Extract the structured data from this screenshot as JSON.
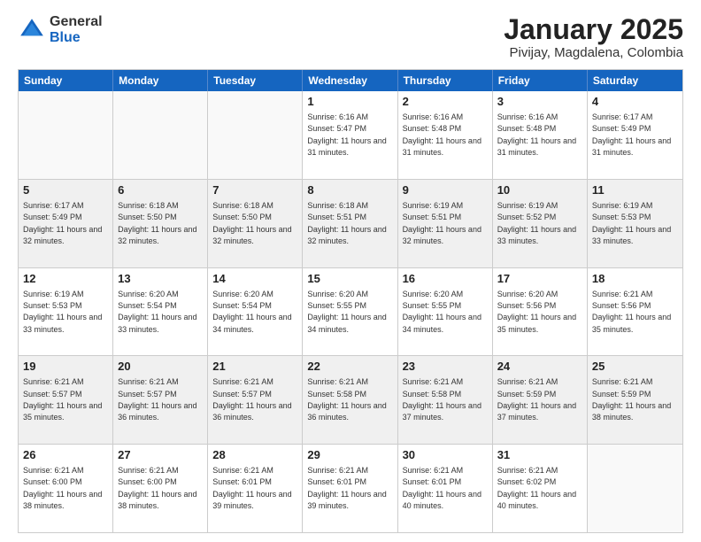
{
  "header": {
    "logo_general": "General",
    "logo_blue": "Blue",
    "title": "January 2025",
    "subtitle": "Pivijay, Magdalena, Colombia"
  },
  "calendar": {
    "days": [
      "Sunday",
      "Monday",
      "Tuesday",
      "Wednesday",
      "Thursday",
      "Friday",
      "Saturday"
    ],
    "weeks": [
      [
        {
          "day": "",
          "empty": true
        },
        {
          "day": "",
          "empty": true
        },
        {
          "day": "",
          "empty": true
        },
        {
          "day": "1",
          "sunrise": "6:16 AM",
          "sunset": "5:47 PM",
          "daylight": "11 hours and 31 minutes."
        },
        {
          "day": "2",
          "sunrise": "6:16 AM",
          "sunset": "5:48 PM",
          "daylight": "11 hours and 31 minutes."
        },
        {
          "day": "3",
          "sunrise": "6:16 AM",
          "sunset": "5:48 PM",
          "daylight": "11 hours and 31 minutes."
        },
        {
          "day": "4",
          "sunrise": "6:17 AM",
          "sunset": "5:49 PM",
          "daylight": "11 hours and 31 minutes."
        }
      ],
      [
        {
          "day": "5",
          "sunrise": "6:17 AM",
          "sunset": "5:49 PM",
          "daylight": "11 hours and 32 minutes."
        },
        {
          "day": "6",
          "sunrise": "6:18 AM",
          "sunset": "5:50 PM",
          "daylight": "11 hours and 32 minutes."
        },
        {
          "day": "7",
          "sunrise": "6:18 AM",
          "sunset": "5:50 PM",
          "daylight": "11 hours and 32 minutes."
        },
        {
          "day": "8",
          "sunrise": "6:18 AM",
          "sunset": "5:51 PM",
          "daylight": "11 hours and 32 minutes."
        },
        {
          "day": "9",
          "sunrise": "6:19 AM",
          "sunset": "5:51 PM",
          "daylight": "11 hours and 32 minutes."
        },
        {
          "day": "10",
          "sunrise": "6:19 AM",
          "sunset": "5:52 PM",
          "daylight": "11 hours and 33 minutes."
        },
        {
          "day": "11",
          "sunrise": "6:19 AM",
          "sunset": "5:53 PM",
          "daylight": "11 hours and 33 minutes."
        }
      ],
      [
        {
          "day": "12",
          "sunrise": "6:19 AM",
          "sunset": "5:53 PM",
          "daylight": "11 hours and 33 minutes."
        },
        {
          "day": "13",
          "sunrise": "6:20 AM",
          "sunset": "5:54 PM",
          "daylight": "11 hours and 33 minutes."
        },
        {
          "day": "14",
          "sunrise": "6:20 AM",
          "sunset": "5:54 PM",
          "daylight": "11 hours and 34 minutes."
        },
        {
          "day": "15",
          "sunrise": "6:20 AM",
          "sunset": "5:55 PM",
          "daylight": "11 hours and 34 minutes."
        },
        {
          "day": "16",
          "sunrise": "6:20 AM",
          "sunset": "5:55 PM",
          "daylight": "11 hours and 34 minutes."
        },
        {
          "day": "17",
          "sunrise": "6:20 AM",
          "sunset": "5:56 PM",
          "daylight": "11 hours and 35 minutes."
        },
        {
          "day": "18",
          "sunrise": "6:21 AM",
          "sunset": "5:56 PM",
          "daylight": "11 hours and 35 minutes."
        }
      ],
      [
        {
          "day": "19",
          "sunrise": "6:21 AM",
          "sunset": "5:57 PM",
          "daylight": "11 hours and 35 minutes."
        },
        {
          "day": "20",
          "sunrise": "6:21 AM",
          "sunset": "5:57 PM",
          "daylight": "11 hours and 36 minutes."
        },
        {
          "day": "21",
          "sunrise": "6:21 AM",
          "sunset": "5:57 PM",
          "daylight": "11 hours and 36 minutes."
        },
        {
          "day": "22",
          "sunrise": "6:21 AM",
          "sunset": "5:58 PM",
          "daylight": "11 hours and 36 minutes."
        },
        {
          "day": "23",
          "sunrise": "6:21 AM",
          "sunset": "5:58 PM",
          "daylight": "11 hours and 37 minutes."
        },
        {
          "day": "24",
          "sunrise": "6:21 AM",
          "sunset": "5:59 PM",
          "daylight": "11 hours and 37 minutes."
        },
        {
          "day": "25",
          "sunrise": "6:21 AM",
          "sunset": "5:59 PM",
          "daylight": "11 hours and 38 minutes."
        }
      ],
      [
        {
          "day": "26",
          "sunrise": "6:21 AM",
          "sunset": "6:00 PM",
          "daylight": "11 hours and 38 minutes."
        },
        {
          "day": "27",
          "sunrise": "6:21 AM",
          "sunset": "6:00 PM",
          "daylight": "11 hours and 38 minutes."
        },
        {
          "day": "28",
          "sunrise": "6:21 AM",
          "sunset": "6:01 PM",
          "daylight": "11 hours and 39 minutes."
        },
        {
          "day": "29",
          "sunrise": "6:21 AM",
          "sunset": "6:01 PM",
          "daylight": "11 hours and 39 minutes."
        },
        {
          "day": "30",
          "sunrise": "6:21 AM",
          "sunset": "6:01 PM",
          "daylight": "11 hours and 40 minutes."
        },
        {
          "day": "31",
          "sunrise": "6:21 AM",
          "sunset": "6:02 PM",
          "daylight": "11 hours and 40 minutes."
        },
        {
          "day": "",
          "empty": true
        }
      ]
    ]
  }
}
